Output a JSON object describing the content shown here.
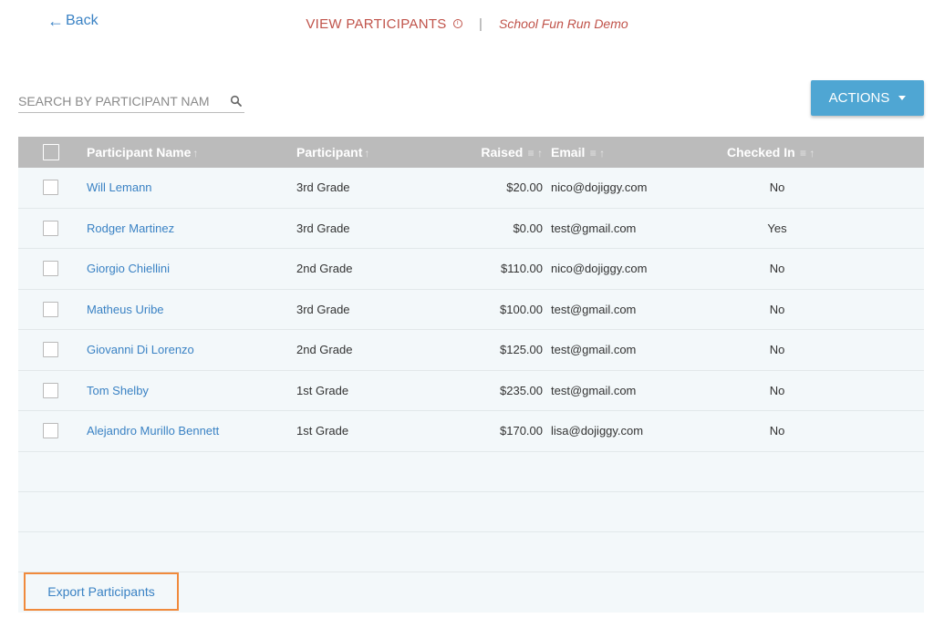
{
  "nav": {
    "back_arrow": "←",
    "back_label": "Back"
  },
  "header": {
    "view_label": "VIEW PARTICIPANTS",
    "info_glyph": "i",
    "separator": "|",
    "event_name": "School Fun Run Demo"
  },
  "search": {
    "placeholder": "SEARCH BY PARTICIPANT NAME",
    "value": ""
  },
  "actions": {
    "label": "ACTIONS"
  },
  "table": {
    "columns": {
      "name": "Participant Name",
      "participant": "Participant",
      "raised": "Raised",
      "email": "Email",
      "checked_in": "Checked In"
    },
    "sort_glyph": "↑",
    "filter_glyph": "≡",
    "rows": [
      {
        "name": "Will Lemann",
        "participant": "3rd Grade",
        "raised": "$20.00",
        "email": "nico@dojiggy.com",
        "checked_in": "No"
      },
      {
        "name": "Rodger Martinez",
        "participant": "3rd Grade",
        "raised": "$0.00",
        "email": "test@gmail.com",
        "checked_in": "Yes"
      },
      {
        "name": "Giorgio Chiellini",
        "participant": "2nd Grade",
        "raised": "$110.00",
        "email": "nico@dojiggy.com",
        "checked_in": "No"
      },
      {
        "name": "Matheus Uribe",
        "participant": "3rd Grade",
        "raised": "$100.00",
        "email": "test@gmail.com",
        "checked_in": "No"
      },
      {
        "name": "Giovanni Di Lorenzo",
        "participant": "2nd Grade",
        "raised": "$125.00",
        "email": "test@gmail.com",
        "checked_in": "No"
      },
      {
        "name": "Tom Shelby",
        "participant": "1st Grade",
        "raised": "$235.00",
        "email": "test@gmail.com",
        "checked_in": "No"
      },
      {
        "name": "Alejandro Murillo Bennett",
        "participant": "1st Grade",
        "raised": "$170.00",
        "email": "lisa@dojiggy.com",
        "checked_in": "No"
      }
    ]
  },
  "footer": {
    "export_label": "Export Participants"
  },
  "colors": {
    "accent_blue": "#4fa6d3",
    "link_blue": "#3a82c4",
    "title_red": "#c0534a",
    "header_gray": "#bbbbbb",
    "highlight_orange": "#f08a3c"
  }
}
